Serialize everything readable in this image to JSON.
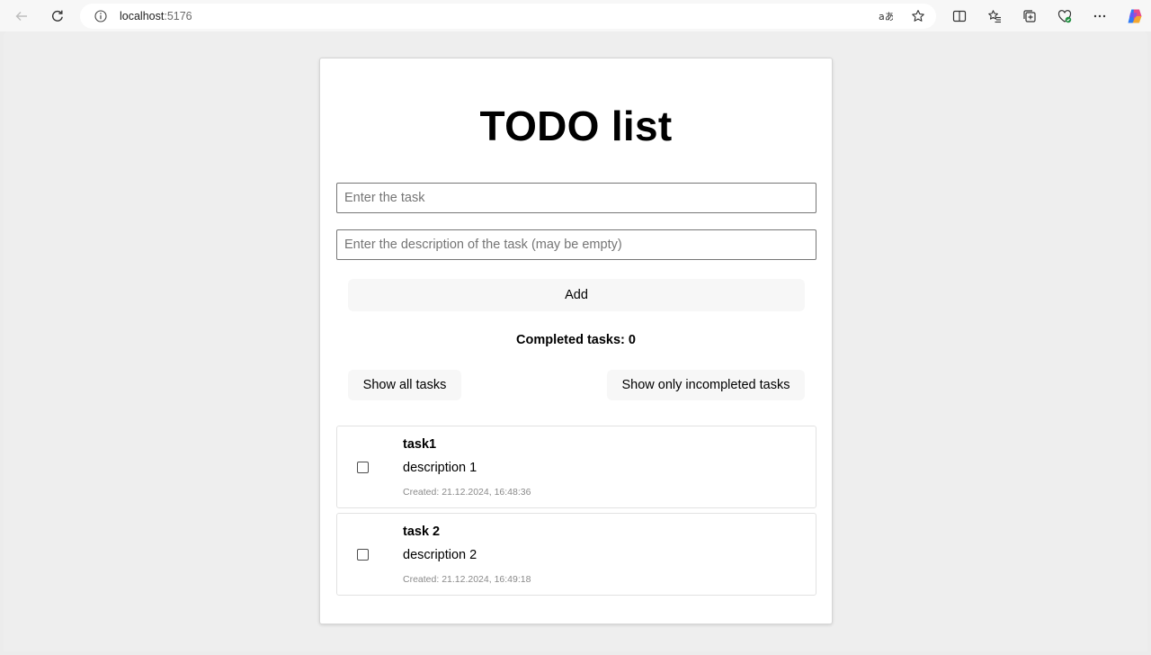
{
  "browser": {
    "url_host": "localhost",
    "url_port": ":5176",
    "icons": [
      "back-icon",
      "reload-icon",
      "info-icon",
      "translate-icon",
      "favorite-star-icon",
      "split-screen-icon",
      "favorites-icon",
      "collections-icon",
      "browser-essentials-icon",
      "more-options-icon",
      "copilot-icon"
    ]
  },
  "page": {
    "title": "TODO list",
    "task_input": {
      "value": "",
      "placeholder": "Enter the task"
    },
    "description_input": {
      "value": "",
      "placeholder": "Enter the description of the task (may be empty)"
    },
    "add_label": "Add",
    "completed_text": "Completed tasks: 0",
    "show_all_label": "Show all tasks",
    "show_incompleted_label": "Show only incompleted tasks",
    "tasks": [
      {
        "title": "task1",
        "description": "description 1",
        "created": "Created: 21.12.2024, 16:48:36",
        "completed": false
      },
      {
        "title": "task 2",
        "description": "description 2",
        "created": "Created: 21.12.2024, 16:49:18",
        "completed": false
      }
    ]
  },
  "colors": {
    "page_background": "#eeeeee",
    "card_background": "#ffffff",
    "button_background": "#f7f7f7",
    "muted_text": "#8a8a8a"
  }
}
